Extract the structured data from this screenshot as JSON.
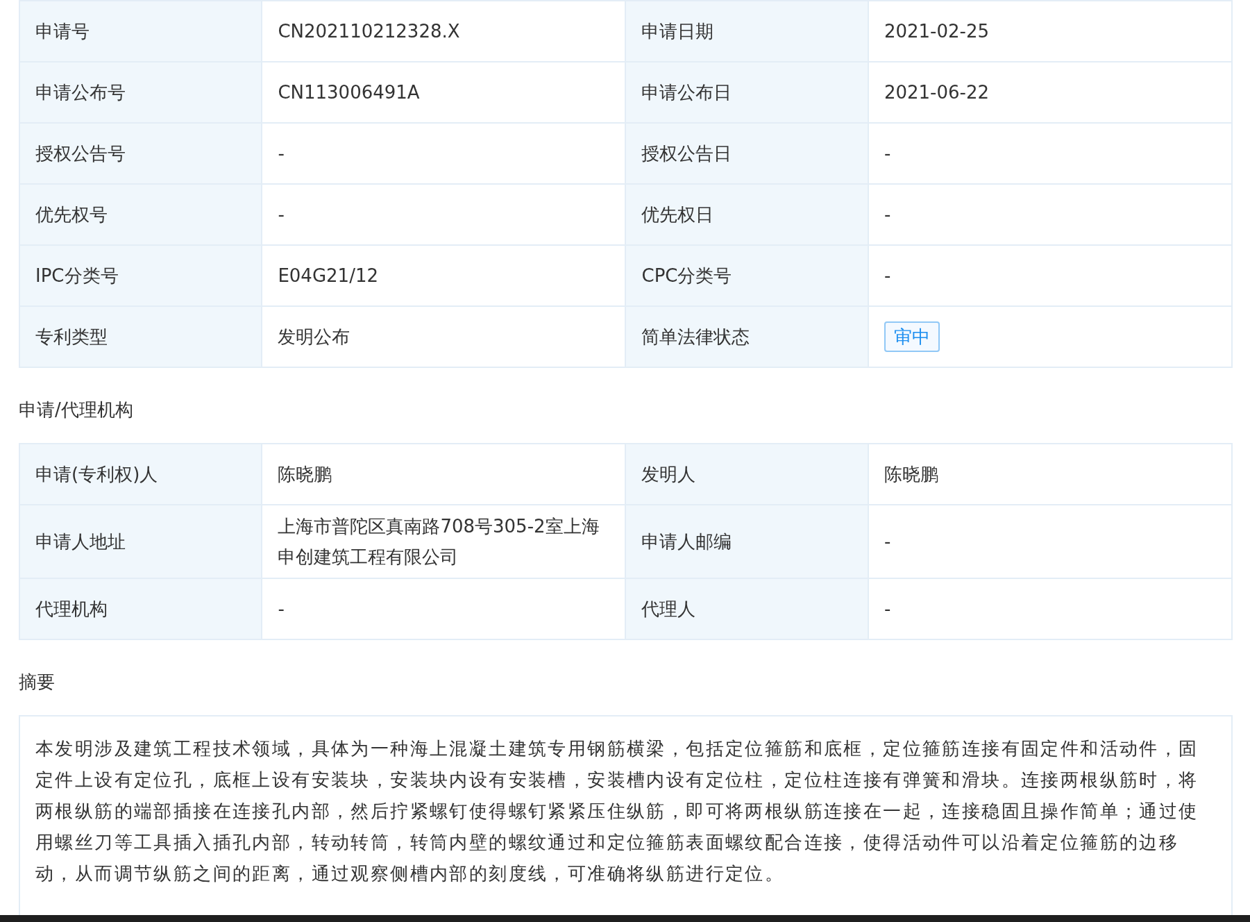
{
  "tables": [
    {
      "rows": [
        [
          {
            "label": "申请号",
            "value": "CN202110212328.X",
            "kind": "text"
          },
          {
            "label": "申请日期",
            "value": "2021-02-25",
            "kind": "text"
          }
        ],
        [
          {
            "label": "申请公布号",
            "value": "CN113006491A",
            "kind": "text"
          },
          {
            "label": "申请公布日",
            "value": "2021-06-22",
            "kind": "text"
          }
        ],
        [
          {
            "label": "授权公告号",
            "value": "-",
            "kind": "text"
          },
          {
            "label": "授权公告日",
            "value": "-",
            "kind": "text"
          }
        ],
        [
          {
            "label": "优先权号",
            "value": "-",
            "kind": "text"
          },
          {
            "label": "优先权日",
            "value": "-",
            "kind": "text"
          }
        ],
        [
          {
            "label": "IPC分类号",
            "value": "E04G21/12",
            "kind": "text"
          },
          {
            "label": "CPC分类号",
            "value": "-",
            "kind": "text"
          }
        ],
        [
          {
            "label": "专利类型",
            "value": "发明公布",
            "kind": "text"
          },
          {
            "label": "简单法律状态",
            "value": "审中",
            "kind": "tag"
          }
        ]
      ]
    },
    {
      "title": "申请/代理机构",
      "rows": [
        [
          {
            "label": "申请(专利权)人",
            "value": "陈晓鹏",
            "kind": "text"
          },
          {
            "label": "发明人",
            "value": "陈晓鹏",
            "kind": "text"
          }
        ],
        [
          {
            "label": "申请人地址",
            "value": "上海市普陀区真南路708号305-2室上海申创建筑工程有限公司",
            "kind": "text"
          },
          {
            "label": "申请人邮编",
            "value": "-",
            "kind": "text"
          }
        ],
        [
          {
            "label": "代理机构",
            "value": "-",
            "kind": "text"
          },
          {
            "label": "代理人",
            "value": "-",
            "kind": "text"
          }
        ]
      ]
    }
  ],
  "abstract": {
    "title": "摘要",
    "text": "本发明涉及建筑工程技术领域，具体为一种海上混凝土建筑专用钢筋横梁，包括定位箍筋和底框，定位箍筋连接有固定件和活动件，固定件上设有定位孔，底框上设有安装块，安装块内设有安装槽，安装槽内设有定位柱，定位柱连接有弹簧和滑块。连接两根纵筋时，将两根纵筋的端部插接在连接孔内部，然后拧紧螺钉使得螺钉紧紧压住纵筋，即可将两根纵筋连接在一起，连接稳固且操作简单；通过使用螺丝刀等工具插入插孔内部，转动转筒，转筒内壁的螺纹通过和定位箍筋表面螺纹配合连接，使得活动件可以沿着定位箍筋的边移动，从而调节纵筋之间的距离，通过观察侧槽内部的刻度线，可准确将纵筋进行定位。"
  }
}
